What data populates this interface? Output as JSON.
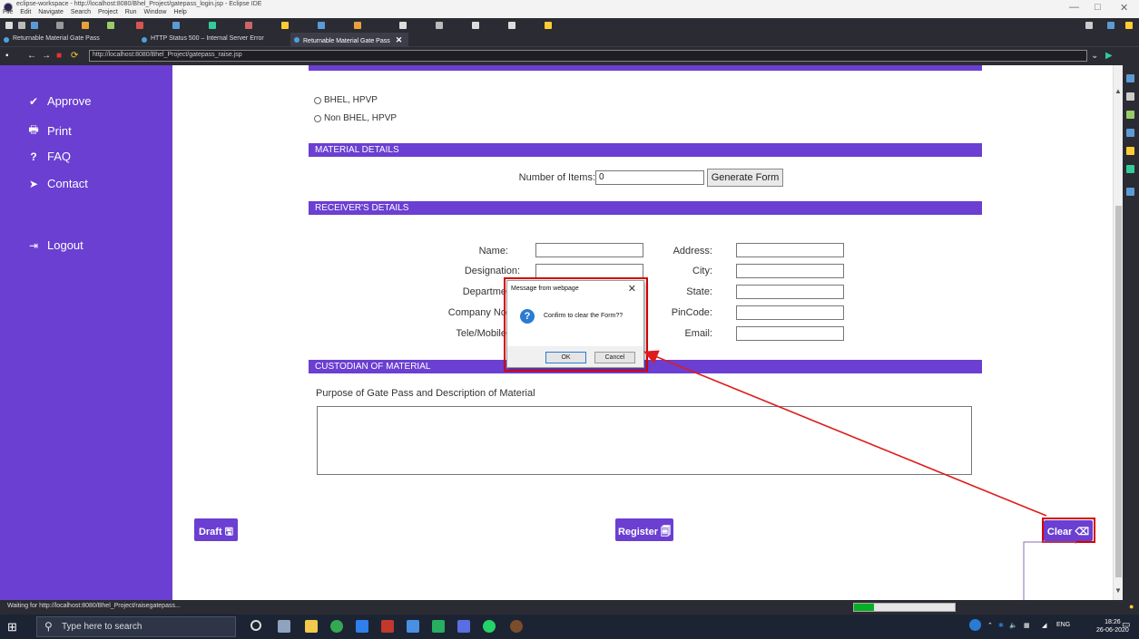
{
  "window": {
    "title": "eclipse-workspace - http://localhost:8080/Bhel_Project/gatepass_login.jsp - Eclipse IDE",
    "menu": [
      "File",
      "Edit",
      "Navigate",
      "Search",
      "Project",
      "Run",
      "Window",
      "Help"
    ],
    "minimize": "—",
    "maximize": "□",
    "close": "✕"
  },
  "tabs": [
    {
      "label": "Returnable Material Gate Pass"
    },
    {
      "label": "HTTP Status 500 – Internal Server Error"
    },
    {
      "label": "Returnable Material Gate Pass",
      "close": "✕"
    }
  ],
  "url": "http://localhost:8080/Bhel_Project/gatepass_raise.jsp",
  "sidebar": {
    "items": [
      {
        "label": "Approve",
        "icon": "✔"
      },
      {
        "label": "Print",
        "icon": "🖶"
      },
      {
        "label": "FAQ",
        "icon": "?"
      },
      {
        "label": "Contact",
        "icon": "➤"
      },
      {
        "label": "Logout",
        "icon": "⇥"
      }
    ]
  },
  "form": {
    "radio1": "BHEL, HPVP",
    "radio2": "Non BHEL, HPVP",
    "material_header": "MATERIAL DETAILS",
    "num_items_label": "Number of Items:",
    "num_items_value": "0",
    "generate_label": "Generate Form",
    "receiver_header": "RECEIVER'S DETAILS",
    "left_labels": [
      "Name:",
      "Designation:",
      "Departme",
      "Company No",
      "Tele/Mobile"
    ],
    "right_labels": [
      "Address:",
      "City:",
      "State:",
      "PinCode:",
      "Email:"
    ],
    "custodian_header": "CUSTODIAN OF MATERIAL",
    "purpose_label": "Purpose of Gate Pass and Description of Material",
    "draft_label": "Draft 🖫",
    "register_label": "Register 🗐",
    "clear_label": "Clear ⌫"
  },
  "dialog": {
    "title": "Message from webpage",
    "close": "✕",
    "message": "Confirm to clear the Form??",
    "ok": "OK",
    "cancel": "Cancel",
    "icon": "?"
  },
  "status": {
    "text": "Waiting for http://localhost:8080/Bhel_Project/raisegatepass...",
    "progress": 0.2
  },
  "taskbar": {
    "search_placeholder": "Type here to search",
    "tray_lang": "ENG",
    "time": "18:26",
    "date": "26-06-2020"
  },
  "colors": {
    "accent": "#6a3fd1",
    "highlight": "#d40000",
    "arrow": "#e01b1b",
    "leader": "#8b6bb5"
  }
}
